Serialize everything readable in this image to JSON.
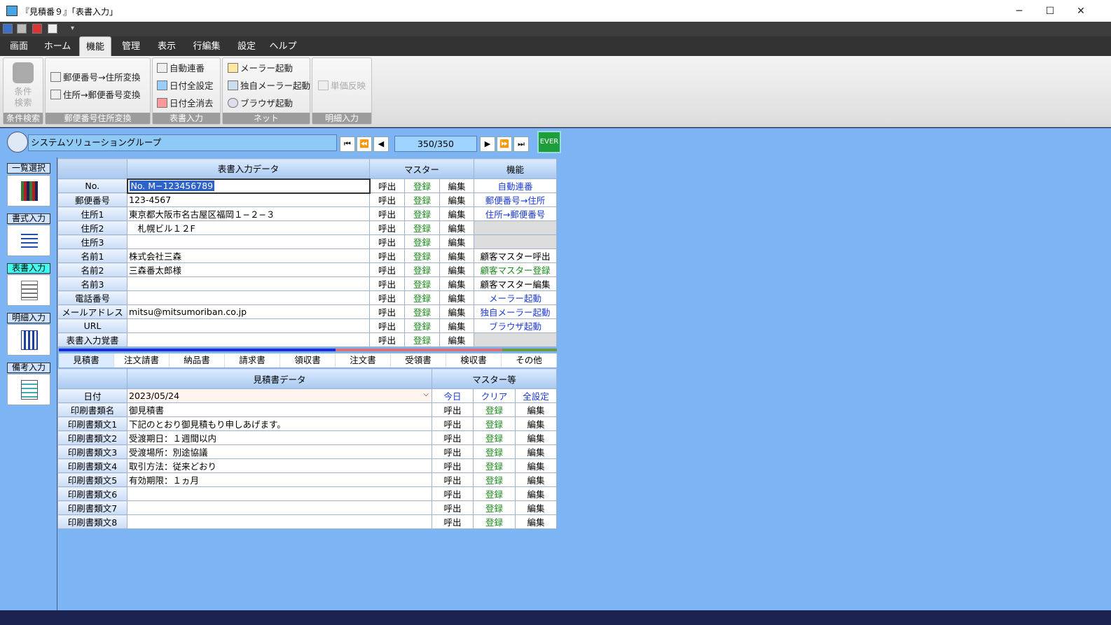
{
  "window": {
    "title": "『見積番９』「表書入力」",
    "minimize": "─",
    "maximize": "☐",
    "close": "✕",
    "qat_more": "▾"
  },
  "menu": [
    "画面",
    "ホーム",
    "機能",
    "管理",
    "表示",
    "行編集",
    "設定",
    "ヘルプ"
  ],
  "menu_active": "機能",
  "ribbon": {
    "search": {
      "label1": "条件",
      "label2": "検索",
      "group": "条件検索"
    },
    "postal": {
      "btn1": "郵便番号→住所変換",
      "btn2": "住所→郵便番号変換",
      "group": "郵便番号住所変換"
    },
    "header_input": {
      "btn1": "自動連番",
      "btn2": "日付全設定",
      "btn3": "日付全消去",
      "group": "表書入力"
    },
    "net": {
      "btn1": "メーラー起動",
      "btn2": "独自メーラー起動",
      "btn3": "ブラウザ起動",
      "group": "ネット"
    },
    "detail": {
      "btn1": "単価反映",
      "group": "明細入力"
    }
  },
  "company": "システムソリューショングループ",
  "pager": "350/350",
  "ever_label": "EVER",
  "side": [
    {
      "label": "一覧選択"
    },
    {
      "label": "書式入力"
    },
    {
      "label": "表書入力"
    },
    {
      "label": "明細入力"
    },
    {
      "label": "備考入力"
    }
  ],
  "header_table": {
    "col_data": "表書入力データ",
    "col_master": "マスター",
    "col_func": "機能",
    "btn_call": "呼出",
    "btn_reg": "登録",
    "btn_edit": "編集",
    "rows": [
      {
        "label": "No.",
        "value": "No. M−123456789",
        "func": "自動連番"
      },
      {
        "label": "郵便番号",
        "value": "123-4567",
        "func": "郵便番号→住所"
      },
      {
        "label": "住所1",
        "value": "東京都大阪市名古屋区福岡１−２−３",
        "func": "住所→郵便番号"
      },
      {
        "label": "住所2",
        "value": "　札幌ビル１２F",
        "func": ""
      },
      {
        "label": "住所3",
        "value": "",
        "func": ""
      },
      {
        "label": "名前1",
        "value": "株式会社三森",
        "func": "顧客マスター呼出"
      },
      {
        "label": "名前2",
        "value": "三森番太郎様",
        "func": "顧客マスター登録"
      },
      {
        "label": "名前3",
        "value": "",
        "func": "顧客マスター編集"
      },
      {
        "label": "電話番号",
        "value": "",
        "func": "メーラー起動"
      },
      {
        "label": "メールアドレス",
        "value": "mitsu@mitsumoriban.co.jp",
        "func": "独自メーラー起動"
      },
      {
        "label": "URL",
        "value": "",
        "func": "ブラウザ起動"
      },
      {
        "label": "表書入力覚書",
        "value": "",
        "func": ""
      }
    ]
  },
  "tabs": [
    "見積書",
    "注文請書",
    "納品書",
    "請求書",
    "領収書",
    "注文書",
    "受領書",
    "検収書",
    "その他"
  ],
  "tab_active": "見積書",
  "doc_table": {
    "col_data": "見積書データ",
    "col_master": "マスター等",
    "date_label": "日付",
    "date_value": "2023/05/24",
    "btn_today": "今日",
    "btn_clear": "クリア",
    "btn_allset": "全設定",
    "btn_call": "呼出",
    "btn_reg": "登録",
    "btn_edit": "編集",
    "rows": [
      {
        "label": "印刷書類名",
        "value": "御見積書"
      },
      {
        "label": "印刷書類文1",
        "value": "下記のとおり御見積もり申しあげます。"
      },
      {
        "label": "印刷書類文2",
        "value": "受渡期日：１週間以内"
      },
      {
        "label": "印刷書類文3",
        "value": "受渡場所：別途協議"
      },
      {
        "label": "印刷書類文4",
        "value": "取引方法：従来どおり"
      },
      {
        "label": "印刷書類文5",
        "value": "有効期限：１ヵ月"
      },
      {
        "label": "印刷書類文6",
        "value": ""
      },
      {
        "label": "印刷書類文7",
        "value": ""
      },
      {
        "label": "印刷書類文8",
        "value": ""
      }
    ]
  }
}
